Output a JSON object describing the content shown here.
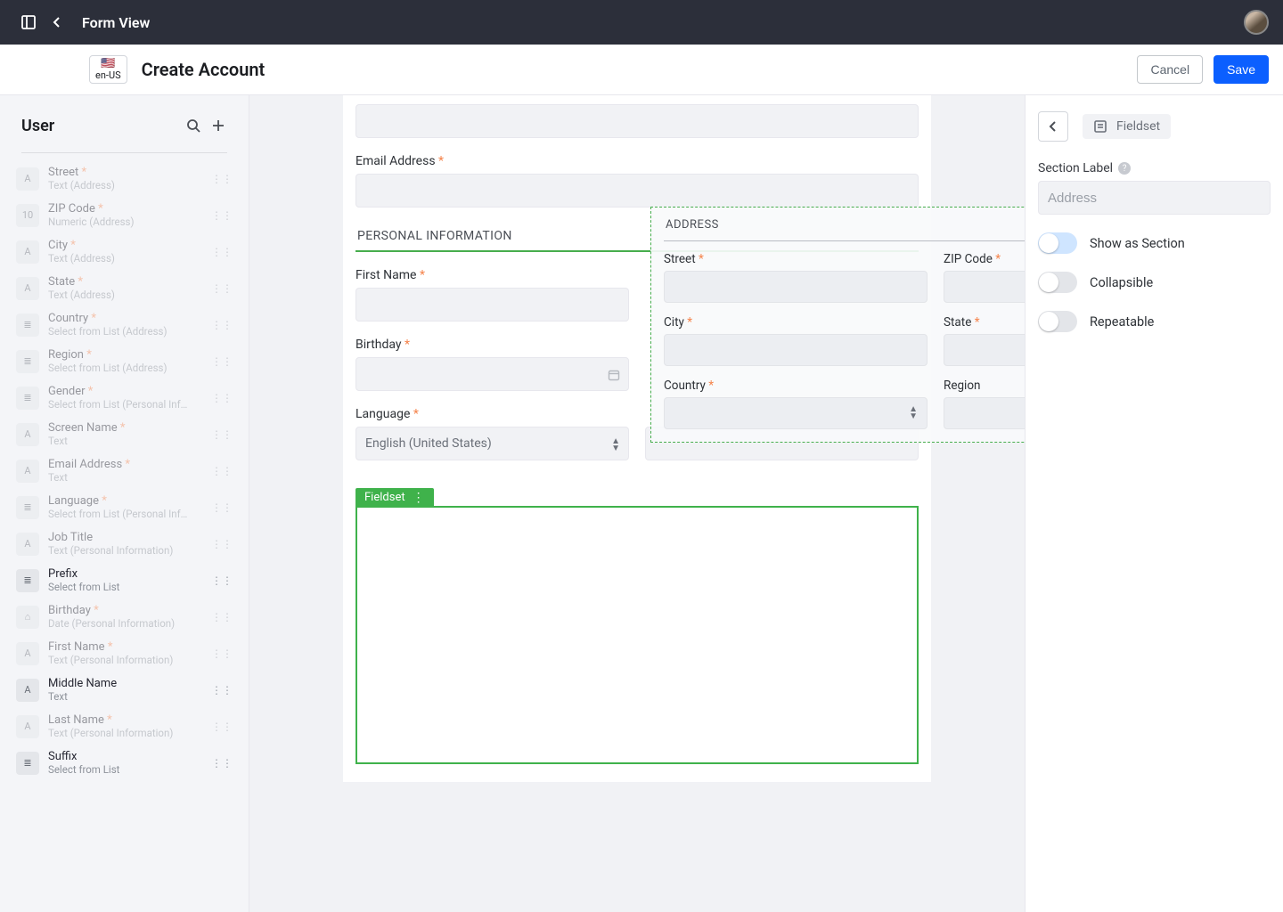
{
  "topbar": {
    "title": "Form View"
  },
  "header": {
    "locale": "en-US",
    "page_title": "Create Account",
    "cancel": "Cancel",
    "save": "Save"
  },
  "sidebar": {
    "title": "User",
    "items": [
      {
        "icon": "A",
        "name": "Street",
        "req": true,
        "sub": "Text (Address)",
        "dim": true
      },
      {
        "icon": "10",
        "name": "ZIP Code",
        "req": true,
        "sub": "Numeric (Address)",
        "dim": true
      },
      {
        "icon": "A",
        "name": "City",
        "req": true,
        "sub": "Text (Address)",
        "dim": true
      },
      {
        "icon": "A",
        "name": "State",
        "req": true,
        "sub": "Text (Address)",
        "dim": true
      },
      {
        "icon": "≣",
        "name": "Country",
        "req": true,
        "sub": "Select from List (Address)",
        "dim": true
      },
      {
        "icon": "≣",
        "name": "Region",
        "req": true,
        "sub": "Select from List (Address)",
        "dim": true
      },
      {
        "icon": "≣",
        "name": "Gender",
        "req": true,
        "sub": "Select from List (Personal Inf…",
        "dim": true
      },
      {
        "icon": "A",
        "name": "Screen Name",
        "req": true,
        "sub": "Text",
        "dim": true
      },
      {
        "icon": "A",
        "name": "Email Address",
        "req": true,
        "sub": "Text",
        "dim": true
      },
      {
        "icon": "≣",
        "name": "Language",
        "req": true,
        "sub": "Select from List (Personal Inf…",
        "dim": true
      },
      {
        "icon": "A",
        "name": "Job Title",
        "req": false,
        "sub": "Text (Personal Information)",
        "dim": true
      },
      {
        "icon": "≣",
        "name": "Prefix",
        "req": false,
        "sub": "Select from List",
        "dim": false
      },
      {
        "icon": "⌂",
        "name": "Birthday",
        "req": true,
        "sub": "Date (Personal Information)",
        "dim": true
      },
      {
        "icon": "A",
        "name": "First Name",
        "req": true,
        "sub": "Text (Personal Information)",
        "dim": true
      },
      {
        "icon": "A",
        "name": "Middle Name",
        "req": false,
        "sub": "Text",
        "dim": false
      },
      {
        "icon": "A",
        "name": "Last Name",
        "req": true,
        "sub": "Text (Personal Information)",
        "dim": true
      },
      {
        "icon": "≣",
        "name": "Suffix",
        "req": false,
        "sub": "Select from List",
        "dim": false
      }
    ]
  },
  "form": {
    "email_label": "Email Address",
    "section_personal": "PERSONAL INFORMATION",
    "first_name": "First Name",
    "birthday": "Birthday",
    "language": "Language",
    "language_value": "English (United States)",
    "fieldset_tag": "Fieldset"
  },
  "drag": {
    "title": "ADDRESS",
    "street": "Street",
    "zip": "ZIP Code",
    "city": "City",
    "state": "State",
    "country": "Country",
    "region": "Region"
  },
  "props": {
    "crumb": "Fieldset",
    "section_label": "Section Label",
    "section_value": "Address",
    "show_as_section": "Show as Section",
    "collapsible": "Collapsible",
    "repeatable": "Repeatable"
  }
}
